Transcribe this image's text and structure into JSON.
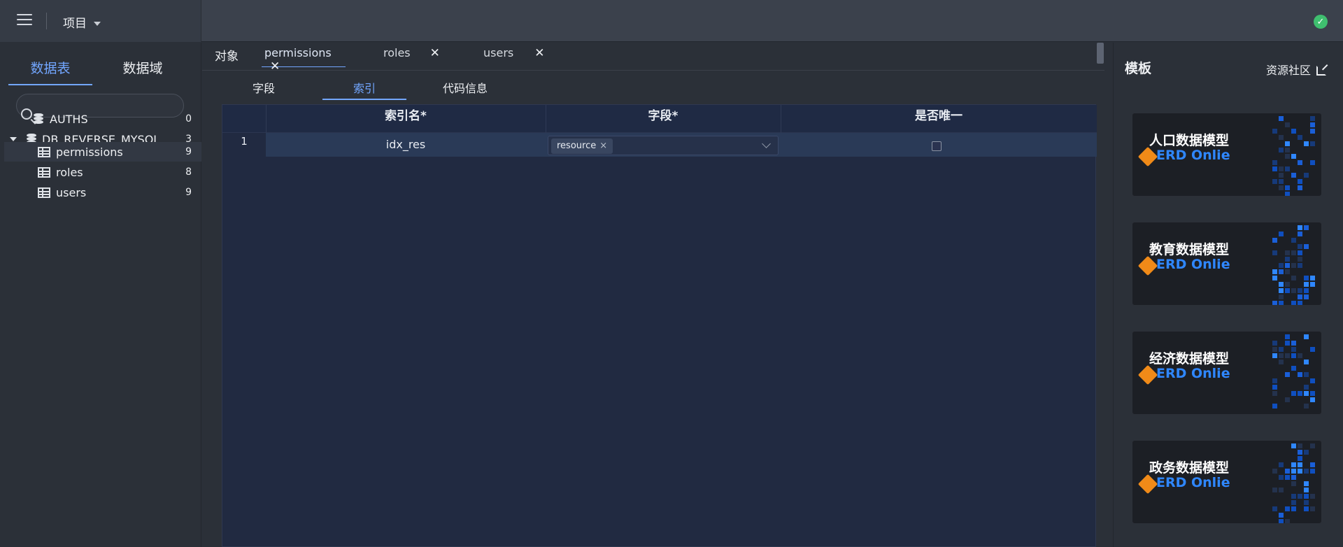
{
  "topbar": {
    "project_label": "项目"
  },
  "sidebar": {
    "tabs": [
      "数据表",
      "数据域"
    ],
    "tree": [
      {
        "label": "AUTHS",
        "count": "0"
      },
      {
        "label": "DB_REVERSE_MYSQL",
        "count": "3"
      },
      {
        "label": "permissions",
        "count": "9"
      },
      {
        "label": "roles",
        "count": "8"
      },
      {
        "label": "users",
        "count": "9"
      }
    ]
  },
  "objtabs": {
    "label": "对象",
    "tabs": [
      "permissions",
      "roles",
      "users"
    ]
  },
  "innertabs": [
    "字段",
    "索引",
    "代码信息"
  ],
  "grid": {
    "headers": [
      "索引名*",
      "字段*",
      "是否唯一"
    ],
    "rows": [
      {
        "num": "1",
        "name": "idx_res",
        "field_tag": "resource",
        "tag_close": "×"
      }
    ]
  },
  "templates": {
    "title": "模板",
    "link": "资源社区",
    "brand": "ERD Onlie",
    "cards": [
      "人口数据模型",
      "教育数据模型",
      "经济数据模型",
      "政务数据模型"
    ]
  },
  "colors": {
    "accent": "#72a6ff",
    "success": "#3fbf6f",
    "brand": "#2f87ff",
    "logo": "#f08a18"
  }
}
